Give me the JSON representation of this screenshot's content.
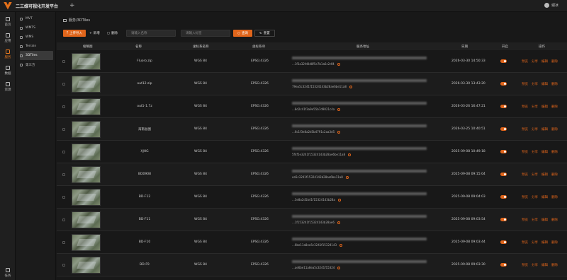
{
  "app": {
    "title": "二三维可视化开发平台",
    "new_tab": "+",
    "user": "谢冰"
  },
  "nav": [
    {
      "label": "首页",
      "icon": "home-icon"
    },
    {
      "label": "应用",
      "icon": "apps-icon"
    },
    {
      "label": "服务",
      "icon": "service-icon",
      "active": true
    },
    {
      "label": "数据",
      "icon": "data-icon"
    },
    {
      "label": "资源",
      "icon": "resource-icon"
    },
    {
      "label": "任务",
      "icon": "task-icon"
    }
  ],
  "subnav": [
    {
      "label": "MVT"
    },
    {
      "label": "WMTS"
    },
    {
      "label": "WMS"
    },
    {
      "label": "Terrain"
    },
    {
      "label": "3DTiles",
      "active": true
    },
    {
      "label": "第三方"
    }
  ],
  "breadcrumb": "服务/3DTiles",
  "toolbar": {
    "upload": "上传导入",
    "add": "新增",
    "delete": "删除",
    "name_placeholder": "请输入名称",
    "tag_placeholder": "请输入标签",
    "search": "查询",
    "reset": "重置"
  },
  "table": {
    "headers": [
      "缩略图",
      "名称",
      "坐标系名称",
      "坐标系ID",
      "服务地址",
      "日期",
      "开启",
      "操作"
    ],
    "actions": [
      "预览",
      "分享",
      "编辑",
      "删除"
    ],
    "rows": [
      {
        "name": "Fluoro.zip",
        "crs": "WGS 84",
        "crs_id": "EPSG:4326",
        "addr": "...1f3a32fd0d8f5e7b1a6c2df4",
        "date": "2026-03-30 14:50:33",
        "enabled": true
      },
      {
        "name": "out12.zip",
        "crs": "WGS 84",
        "crs_id": "EPSG:4326",
        "addr": "79ea5c3241f15324143b28ae6be11a8",
        "date": "2026-03-30 13:43:20",
        "enabled": true
      },
      {
        "name": "out1-1.7z",
        "crs": "WGS 84",
        "crs_id": "EPSG:4326",
        "addr": "...8d2c41f3a9e55b7d9021c4a",
        "date": "2026-03-26 16:47:21",
        "enabled": true
      },
      {
        "name": "海南总图",
        "crs": "WGS 84",
        "crs_id": "EPSG:4326",
        "addr": "...6c1f3e8a2d5b4791c2aa3d5",
        "date": "2026-03-25 10:40:51",
        "enabled": true
      },
      {
        "name": "XJHG",
        "crs": "WGS 84",
        "crs_id": "EPSG:4326",
        "addr": "5f4f5e3241f15324143b28ae6be11a8",
        "date": "2025-09-08 10:49:18",
        "enabled": true
      },
      {
        "name": "BD0908",
        "crs": "WGS 84",
        "crs_id": "EPSG:4326",
        "addr": "ea5c3241f15324143b28ae6be11a8",
        "date": "2025-09-08 09:15:04",
        "enabled": true
      },
      {
        "name": "BD-F12",
        "crs": "WGS 84",
        "crs_id": "EPSG:4326",
        "addr": "...3e8a2d5b41f15324143b28a",
        "date": "2025-09-08 09:04:03",
        "enabled": true
      },
      {
        "name": "BD-F11",
        "crs": "WGS 84",
        "crs_id": "EPSG:4326",
        "addr": "...1f153241f15324143b28ae6",
        "date": "2025-09-08 09:03:54",
        "enabled": true
      },
      {
        "name": "BD-F10",
        "crs": "WGS 84",
        "crs_id": "EPSG:4326",
        "addr": "...6be11a8ea5c3241f15324143",
        "date": "2025-09-08 09:03:44",
        "enabled": true
      },
      {
        "name": "BD-F9",
        "crs": "WGS 84",
        "crs_id": "EPSG:4326",
        "addr": "...ae6be11a8ea5c3241f15324",
        "date": "2025-09-08 09:03:30",
        "enabled": true
      }
    ]
  },
  "colors": {
    "accent": "#e0651b",
    "bg": "#181818",
    "panel": "#1f1f1f"
  }
}
